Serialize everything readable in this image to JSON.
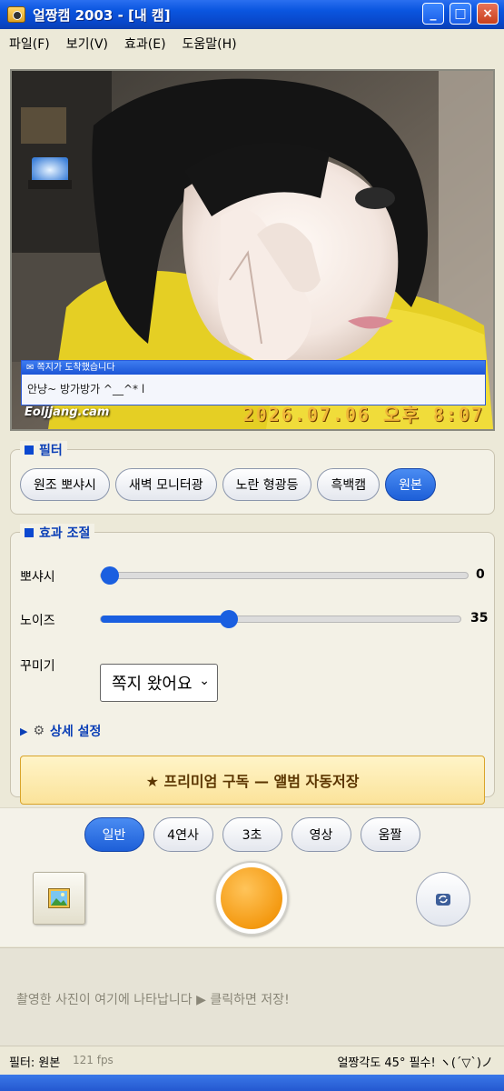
{
  "window": {
    "title": "얼짱캠 2003 - [내 캠]",
    "buttons": {
      "minimize": "_",
      "maximize": "□",
      "close": "×"
    }
  },
  "menu": [
    "파일(F)",
    "보기(V)",
    "효과(E)",
    "도움말(H)"
  ],
  "camera": {
    "popup_title": "✉ 쪽지가 도착했습니다",
    "popup_message": "안냥~ 방가방가 ^__^* l",
    "watermark": "Eoljjang.cam",
    "timestamp": "2026.07.06 오후 8:07"
  },
  "filters": {
    "legend": "필터",
    "items": [
      "원조 뽀샤시",
      "새벽 모니터광",
      "노란 형광등",
      "흑백캠",
      "원본"
    ],
    "active": "원본"
  },
  "effects": {
    "legend": "효과 조절",
    "sliders": [
      {
        "label": "뽀샤시",
        "value": 0,
        "display": "0"
      },
      {
        "label": "노이즈",
        "value": 35,
        "display": "35",
        "max": 100
      }
    ],
    "decorate_label": "꾸미기",
    "decorate_value": "쪽지 왔어요",
    "advanced_label": "상세 설정",
    "premium_label": "★ 프리미엄 구독 — 앨범 자동저장"
  },
  "capture": {
    "modes": [
      "일반",
      "4연사",
      "3초",
      "영상",
      "움짤"
    ],
    "active_mode": "일반"
  },
  "strip": {
    "placeholder": "촬영한 사진이 여기에 나타납니다 ▶ 클릭하면 저장!"
  },
  "status": {
    "filter": "필터: 원본",
    "fps": "121 fps",
    "tip": "얼짱각도 45° 필수! ヽ(´▽`)ノ"
  },
  "colors": {
    "accent": "#1d5fd8",
    "titlebar": "#0b56e0",
    "shutter": "#f49a12",
    "timestamp": "#f0b838",
    "premium": "#fbe39a"
  }
}
